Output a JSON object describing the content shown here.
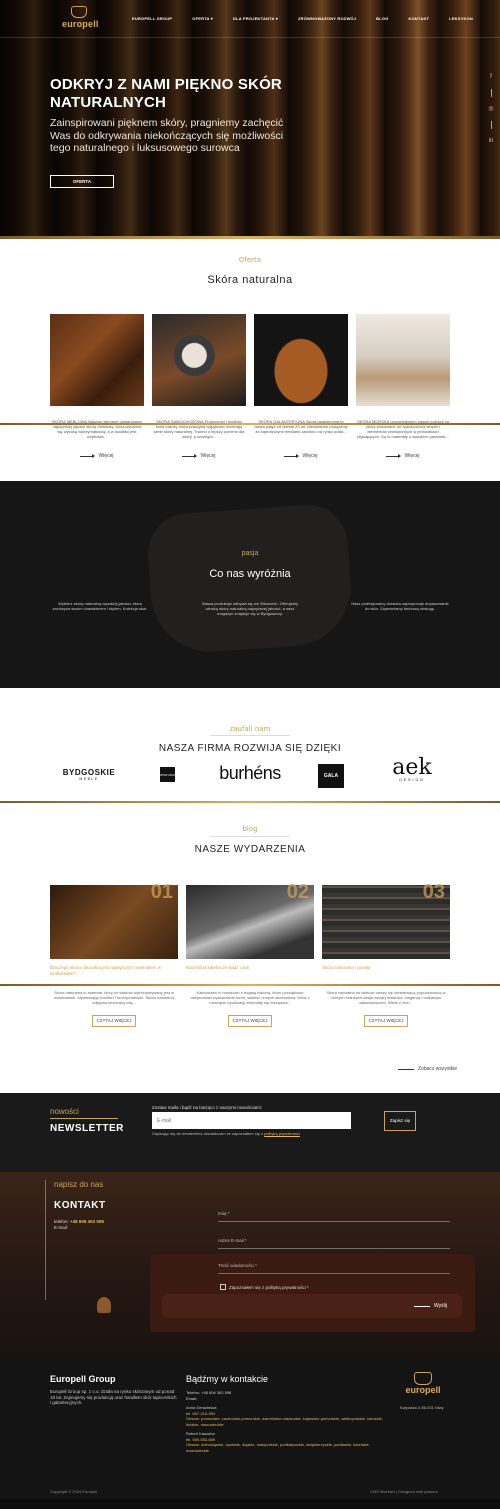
{
  "nav": {
    "logo": "europell",
    "items": [
      "EUROPELL GROUP",
      "OFERTA ▾",
      "DLA PROJEKTANTA ▾",
      "ZRÓWNOWAŻONY ROZWÓJ",
      "BLOG",
      "KONTAKT",
      "LEKSYKON"
    ]
  },
  "hero": {
    "title": "ODKRYJ Z NAMI PIĘKNO SKÓR NATURALNYCH",
    "subtitle": "Zainspirowani pięknem skóry, pragniemy zachęcić Was do odkrywania niekończących się możliwości tego naturalnego i luksusowego surowca",
    "button": "OFERTA"
  },
  "social": [
    "f",
    "in"
  ],
  "offer": {
    "kicker": "Oferta",
    "title": "Skóra naturalna",
    "cards": [
      {
        "caption": "SKÓRA MEBLOWA Naszym klientom dostarczamy najwyższej jakości skórę meblową, która wyróżnia się wysoką wytrzymałością, a w dodatku jest użytkowa...",
        "more": "Więcej"
      },
      {
        "caption": "SKÓRA SAMOCHODOWA Producenci i możliwy kolor branży motoryzacyjnej wyjątkowo docenają wiele skóry naturalnej. Trudno o lepszy pomimo dla skóry, a szczegół...",
        "more": "Więcej"
      },
      {
        "caption": "SKÓRA GALANTERYJNA Skóra galanteryjna to nasza pasja od niemal 20 lat. Nieustannie podążamy za najnowszymi trendami zarówno na rynku polsk...",
        "more": "Więcej"
      },
      {
        "caption": "SKÓRA MORSKA Uzupełnieniem naszej kolekcji są skóry stosowane do wykończenia wnętrz i elementów zewnętrznych w jednostkach pływających. Są to materiały o wysokich parametr...",
        "more": "Więcej"
      }
    ]
  },
  "passion": {
    "kicker": "pasja",
    "title": "Co nas wyróżnia",
    "cols": [
      "Wybierz skórę naturalną wysokiej jakości, która zachwyca swoim charakterem i stylem. Kolekcja skór.",
      "Nasza produkcja odbywa się we Włoszech. Oferujemy włoską skórę naturalną najwyższej jakości, a nasz magazyn znajduje się w Bydgoszczy.",
      "Nasz profesjonalny doradca zaproponuje dopasowanie do skór. Zapewniamy fachową obsługę."
    ]
  },
  "trusted": {
    "kicker": "zaufali nam",
    "title": "NASZA FIRMA ROZWIJA SIĘ DZIĘKI",
    "logos": [
      "BYDGOSKIE",
      "MEBLE",
      "STAP MAX",
      "burhéns",
      "GALA",
      "aek",
      "DESIGN"
    ]
  },
  "blog": {
    "kicker": "blog",
    "title": "NASZE WYDARZENIA",
    "posts": [
      {
        "num": "01",
        "title": "Dlaczego skóra naturalna jest najlepszym materiałem w siodlarstwie?",
        "excerpt": "Skóra naturalna to materiał, który od wieków wykorzystywany jest w siodlarstwie, zapewniając komfort i funkcjonalność. Skóra naturalna odgrywa kluczową rolę...",
        "button": "CZYTAJ WIĘCEJ"
      },
      {
        "num": "02",
        "title": "Narzędzia kaletnicze bądź i dok",
        "excerpt": "Kaletnictwo to rzemiosło z bogatą historią, które początkowo obejmowało wytwarzanie toreb, sakiew i innych akcesoriów. Wraz z rozwojem cywilizacji zmieniały się narzędzia...",
        "button": "CZYTAJ WIĘCEJ"
      },
      {
        "num": "03",
        "title": "Skóra naturalna i postęp",
        "excerpt": "Skóra naturalna od wieków cieszy się niesłabnącą popularnością w różnych branżach dzięki swojej trwałości, elegancji i unikalnym właściwościom. Wiele z nich...",
        "button": "CZYTAJ WIĘCEJ"
      }
    ],
    "see_all": "Zobacz wszystkie"
  },
  "newsletter": {
    "kicker": "nowości",
    "title": "NEWSLETTER",
    "lead": "Zostaw maila i bądź na bieżąco z naszymi nowościami:",
    "placeholder": "E-mail",
    "consent_prefix": "Zapisując się do newslettera oświadczam że zapoznałem się z",
    "consent_link": "polityką prywatności",
    "button": "Zapisz się"
  },
  "contact": {
    "kicker": "napisz do nas",
    "title": "KONTAKT",
    "phone_label": "telefon:",
    "phone": "+48 606 363 598",
    "email_label": "E-mail:",
    "fields": [
      "Imię *",
      "Adres E-mail *",
      "Treść wiadomości *"
    ],
    "consent": "Zapoznałem się z polityką prywatności *",
    "send": "Wyślij"
  },
  "footer": {
    "company": "Europell Group",
    "about": "Europell Group sp. z o.o. działa na rynku skórzanym od ponad 18 lat. Zajmujemy się produkcją oraz handlem skór tapicerskich i galanteryjnych.",
    "contact_title": "Bądźmy w kontakcie",
    "phone": "Telefon: +48 606 363 598",
    "email": "Email:",
    "rep1_name": "Anna Derdzińska",
    "rep1_phone": "tel. 697-215-993",
    "rep1_regions": "Obszar: pomorskie, zachodnio-pomorskie, warmińsko-mazurskie, kujawsko-pomorskie, wielkopolskie, lubuskie, łódzkie, mazowieckie",
    "rep2_name": "Robert Kaszuba",
    "rep2_phone": "tel. 500-553-669",
    "rep2_regions": "Obszar: dolnośląskie, opolskie, śląskie, małopolskie, podkarpackie, świętokrzyskie, podlaskie, lubelskie, mazowieckie",
    "logo": "europell",
    "address": "Karpacka 3 86-031 Niwy",
    "copyright": "Copyright © 2024 Europell",
    "credits": "CMS Meehart | Designed with passion"
  }
}
